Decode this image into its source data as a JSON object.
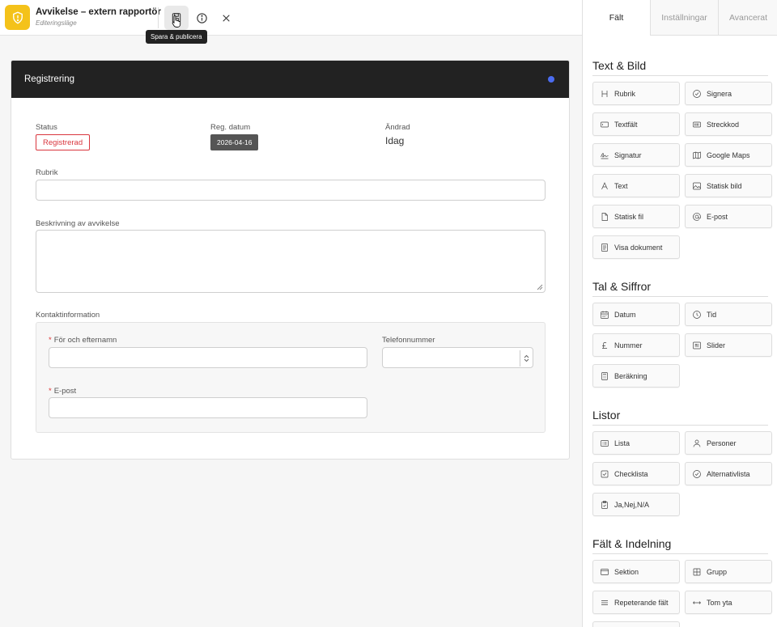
{
  "header": {
    "title": "Avvikelse – extern rapportör",
    "subtitle": "Editeringsläge",
    "tooltip": "Spara & publicera"
  },
  "form": {
    "section_title": "Registrering",
    "status_label": "Status",
    "status_value": "Registrerad",
    "reg_date_label": "Reg. datum",
    "reg_date_value": "2026-04-16",
    "changed_label": "Ändrad",
    "changed_value": "Idag",
    "heading_label": "Rubrik",
    "description_label": "Beskrivning av avvikelse",
    "contact_label": "Kontaktinformation",
    "name_label": "För och efternamn",
    "phone_label": "Telefonnummer",
    "email_label": "E-post",
    "required_mark": "*"
  },
  "panel": {
    "tabs": [
      "Fält",
      "Inställningar",
      "Avancerat"
    ],
    "sections": [
      {
        "title": "Text & Bild",
        "items": [
          {
            "label": "Rubrik",
            "icon": "heading-icon"
          },
          {
            "label": "Signera",
            "icon": "check-circle-icon"
          },
          {
            "label": "Textfält",
            "icon": "textfield-icon"
          },
          {
            "label": "Streckkod",
            "icon": "barcode-icon"
          },
          {
            "label": "Signatur",
            "icon": "signature-icon"
          },
          {
            "label": "Google Maps",
            "icon": "map-icon"
          },
          {
            "label": "Text",
            "icon": "text-icon"
          },
          {
            "label": "Statisk bild",
            "icon": "image-icon"
          },
          {
            "label": "Statisk fil",
            "icon": "file-icon"
          },
          {
            "label": "E-post",
            "icon": "at-icon"
          },
          {
            "label": "Visa dokument",
            "icon": "document-icon"
          }
        ]
      },
      {
        "title": "Tal & Siffror",
        "items": [
          {
            "label": "Datum",
            "icon": "calendar-icon"
          },
          {
            "label": "Tid",
            "icon": "clock-icon"
          },
          {
            "label": "Nummer",
            "icon": "currency-icon"
          },
          {
            "label": "Slider",
            "icon": "slider-icon"
          },
          {
            "label": "Beräkning",
            "icon": "calculator-icon"
          }
        ]
      },
      {
        "title": "Listor",
        "items": [
          {
            "label": "Lista",
            "icon": "list-icon"
          },
          {
            "label": "Personer",
            "icon": "person-icon"
          },
          {
            "label": "Checklista",
            "icon": "checkbox-icon"
          },
          {
            "label": "Alternativlista",
            "icon": "check-circle-icon"
          },
          {
            "label": "Ja,Nej,N/A",
            "icon": "clipboard-icon"
          }
        ]
      },
      {
        "title": "Fält & Indelning",
        "items": [
          {
            "label": "Sektion",
            "icon": "section-icon"
          },
          {
            "label": "Grupp",
            "icon": "grid-icon"
          },
          {
            "label": "Repeterande fält",
            "icon": "lines-icon"
          },
          {
            "label": "Tom yta",
            "icon": "arrows-h-icon"
          }
        ]
      }
    ]
  },
  "colors": {
    "accent": "#f4c21a",
    "status_red": "#d9363e",
    "header_dark": "#222222",
    "dot_blue": "#4b6cf0"
  }
}
